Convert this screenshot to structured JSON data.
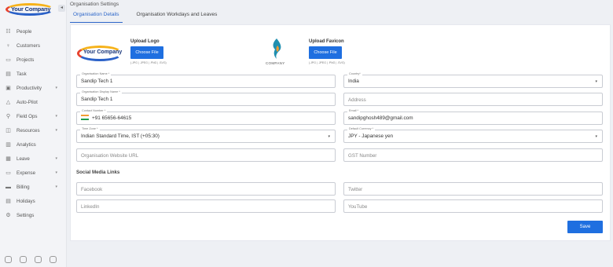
{
  "brand": {
    "name": "Your Company"
  },
  "sidebar": {
    "collapse_icon": "collapse-icon",
    "items": [
      {
        "label": "People",
        "icon": "people-icon",
        "chevron": false
      },
      {
        "label": "Customers",
        "icon": "customers-icon",
        "chevron": false
      },
      {
        "label": "Projects",
        "icon": "projects-icon",
        "chevron": false
      },
      {
        "label": "Task",
        "icon": "task-icon",
        "chevron": false
      },
      {
        "label": "Productivity",
        "icon": "productivity-icon",
        "chevron": true
      },
      {
        "label": "Auto-Pilot",
        "icon": "autopilot-icon",
        "chevron": false
      },
      {
        "label": "Field Ops",
        "icon": "field-ops-icon",
        "chevron": true
      },
      {
        "label": "Resources",
        "icon": "resources-icon",
        "chevron": true
      },
      {
        "label": "Analytics",
        "icon": "analytics-icon",
        "chevron": false
      },
      {
        "label": "Leave",
        "icon": "leave-icon",
        "chevron": true
      },
      {
        "label": "Expense",
        "icon": "expense-icon",
        "chevron": true
      },
      {
        "label": "Billing",
        "icon": "billing-icon",
        "chevron": true
      },
      {
        "label": "Holidays",
        "icon": "holidays-icon",
        "chevron": false
      },
      {
        "label": "Settings",
        "icon": "settings-icon",
        "chevron": false
      }
    ]
  },
  "header": {
    "title": "Organisation Settings",
    "tabs": [
      {
        "label": "Organisation Details",
        "active": true
      },
      {
        "label": "Organisation Workdays and Leaves",
        "active": false
      }
    ]
  },
  "uploads": {
    "logo": {
      "label": "Upload Logo",
      "button": "Choose File",
      "hint": "(.JPG | .JPEG | .PNG | .SVG)"
    },
    "favicon": {
      "label": "Upload Favicon",
      "button": "Choose File",
      "hint": "(.JPG | .JPEG | .PNG | .SVG)",
      "caption": "COMPANY"
    }
  },
  "form": {
    "org_name": {
      "label": "Organisation Name *",
      "value": "Sandip Tech 1"
    },
    "country": {
      "label": "Country*",
      "value": "India"
    },
    "display_name": {
      "label": "Organisation Display Name *",
      "value": "Sandip Tech 1"
    },
    "address": {
      "placeholder": "Address"
    },
    "contact": {
      "label": "Contact Number *",
      "value": "+91 65656-64615"
    },
    "email": {
      "label": "Email *",
      "value": "sandipghosh489@gmail.com"
    },
    "timezone": {
      "label": "Time Zone *",
      "value": "Indian Standard Time, IST (+05:30)"
    },
    "currency": {
      "label": "Default Currency *",
      "value": "JPY - Japanese yen"
    },
    "website": {
      "placeholder": "Organisation Website URL"
    },
    "gst": {
      "placeholder": "GST Number"
    }
  },
  "social": {
    "title": "Social Media Links",
    "facebook": "Facebook",
    "twitter": "Twitter",
    "linkedin": "LinkedIn",
    "youtube": "YouTube"
  },
  "actions": {
    "save": "Save"
  },
  "colors": {
    "primary": "#1f6fe0",
    "tab_active": "#2c66c9"
  }
}
